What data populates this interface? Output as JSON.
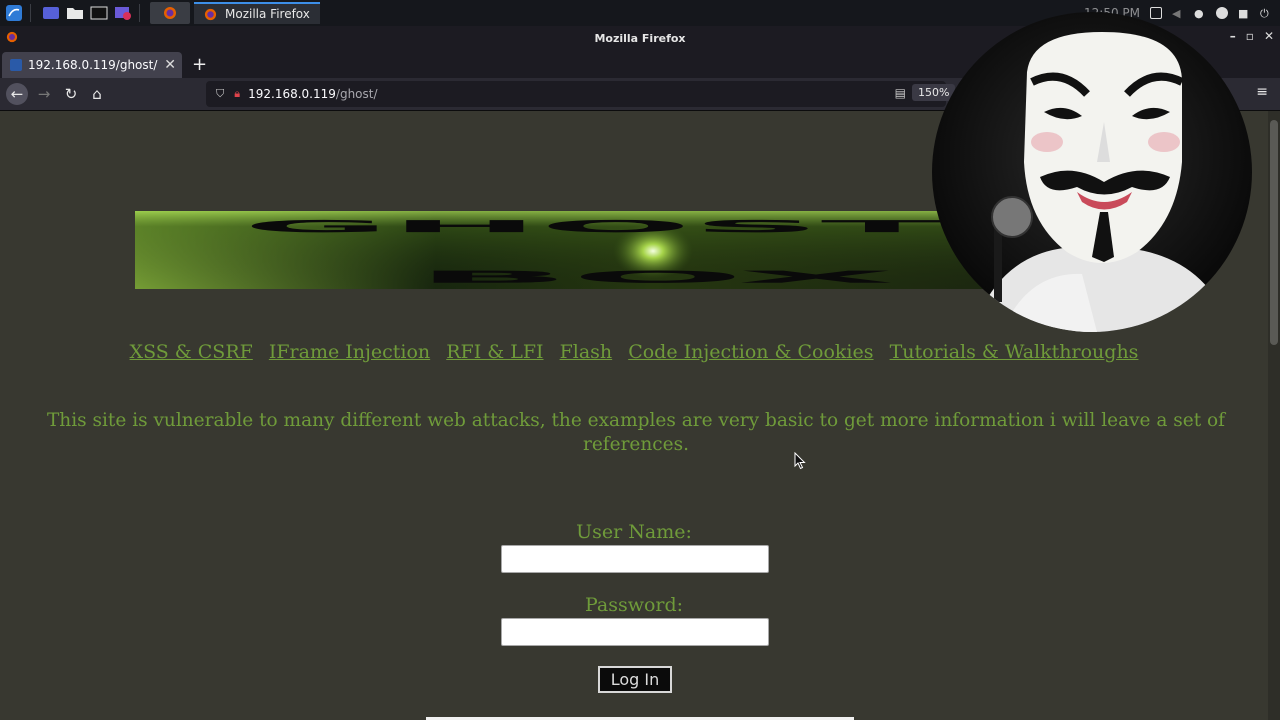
{
  "taskbar": {
    "app_title": "Mozilla Firefox",
    "clock": "12:50 PM"
  },
  "window": {
    "title": "Mozilla Firefox"
  },
  "tab": {
    "title": "192.168.0.119/ghost/"
  },
  "urlbar": {
    "host": "192.168.0.119",
    "path": "/ghost/",
    "zoom": "150%"
  },
  "page": {
    "banner_title_line1": "GHOST",
    "banner_title_line2": "BOX",
    "nav_links": [
      "XSS & CSRF",
      "IFrame Injection",
      "RFI & LFI",
      "Flash",
      "Code Injection & Cookies",
      "Tutorials & Walkthroughs"
    ],
    "intro_text": "This site is vulnerable to many different web attacks, the examples are very basic to get more information i will leave a set of references.",
    "login": {
      "username_label": "User Name:",
      "password_label": "Password:",
      "submit_label": "Log In"
    }
  },
  "colors": {
    "page_bg": "#383830",
    "link_green": "#6f9b3a",
    "chrome_dark": "#1c1b22"
  },
  "icons": [
    "kali-menu-icon",
    "workspace-icon",
    "files-icon",
    "terminal-icon",
    "firefox-icon",
    "shield-icon",
    "lock-strike-icon",
    "reader-view-icon",
    "hamburger-menu-icon"
  ]
}
